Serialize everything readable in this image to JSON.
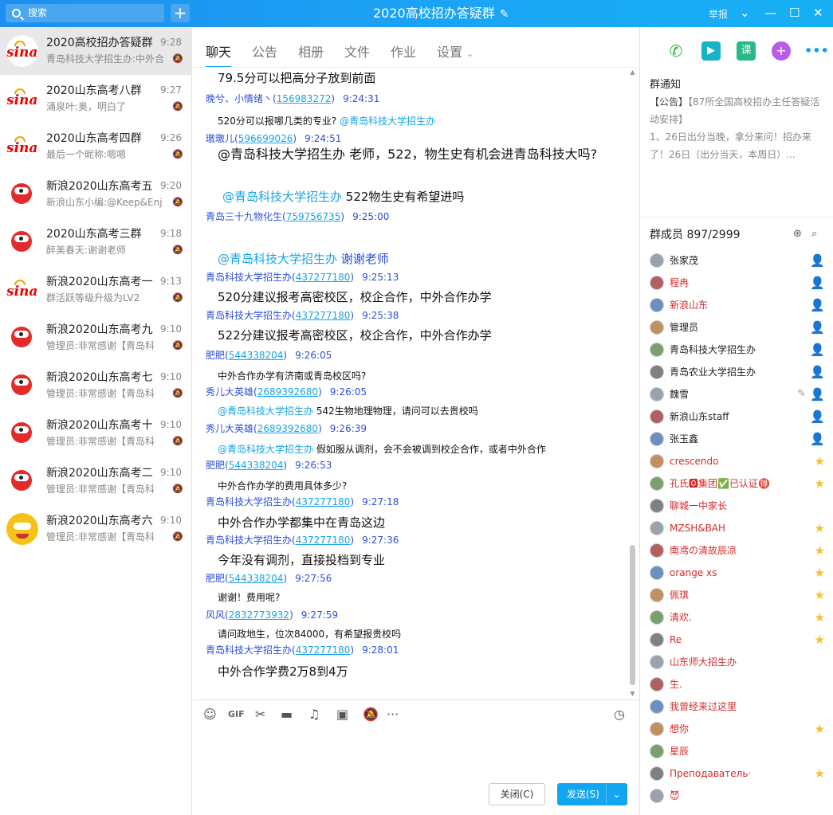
{
  "app": {
    "window_title": "2020高校招办答疑群",
    "report_label": "举报"
  },
  "search": {
    "placeholder": "搜索"
  },
  "conversations": [
    {
      "name": "2020高校招办答疑群",
      "time": "9:28",
      "preview": "青岛科技大学招生办:中外合",
      "avatar": "sina",
      "active": true
    },
    {
      "name": "2020山东高考八群",
      "time": "9:27",
      "preview": "涌泉叶:奥，明白了",
      "avatar": "sina"
    },
    {
      "name": "2020山东高考四群",
      "time": "9:26",
      "preview": "最后一个昵称:嗯嗯",
      "avatar": "sina"
    },
    {
      "name": "新浪2020山东高考五",
      "time": "9:20",
      "preview": "新浪山东小编:@Keep&Enj",
      "avatar": "mascot"
    },
    {
      "name": "2020山东高考三群",
      "time": "9:18",
      "preview": "醉美春天:谢谢老师",
      "avatar": "mascot"
    },
    {
      "name": "新浪2020山东高考一",
      "time": "9:13",
      "preview": "群活跃等级升级为LV2",
      "avatar": "sina"
    },
    {
      "name": "新浪2020山东高考九",
      "time": "9:10",
      "preview": "管理员:非常感谢【青岛科",
      "avatar": "mascot"
    },
    {
      "name": "新浪2020山东高考七",
      "time": "9:10",
      "preview": "管理员:非常感谢【青岛科",
      "avatar": "mascot"
    },
    {
      "name": "新浪2020山东高考十",
      "time": "9:10",
      "preview": "管理员:非常感谢【青岛科",
      "avatar": "mascot"
    },
    {
      "name": "新浪2020山东高考二",
      "time": "9:10",
      "preview": "管理员:非常感谢【青岛科",
      "avatar": "mascot"
    },
    {
      "name": "新浪2020山东高考六",
      "time": "9:10",
      "preview": "管理员:非常感谢【青岛科",
      "avatar": "yellow"
    }
  ],
  "tabs": {
    "chat": "聊天",
    "notice": "公告",
    "album": "相册",
    "files": "文件",
    "homework": "作业",
    "settings": "设置"
  },
  "messages": [
    {
      "kind": "body",
      "text": "79.5分可以把高分子放到前面",
      "size": 15
    },
    {
      "kind": "sender",
      "nick": "晚兮、小情绪丶",
      "qq": "156983272",
      "time": "9:24:31"
    },
    {
      "kind": "body",
      "text": "520分可以报哪几类的专业?",
      "at": "@青岛科技大学招生办",
      "at_after": true,
      "size": 12
    },
    {
      "kind": "sender",
      "nick": "璬璬儿",
      "qq": "596699026",
      "time": "9:24:51"
    },
    {
      "kind": "body",
      "text": "@青岛科技大学招生办 老师，522，物生史有机会进青岛科技大吗?",
      "size": 16
    },
    {
      "kind": "body",
      "at": "@青岛科技大学招生办",
      "text": " 522物生史有希望进吗",
      "size": 15,
      "indent": true
    },
    {
      "kind": "sender",
      "nick": "青岛三十九物化生",
      "qq": "759756735",
      "time": "9:25:00"
    },
    {
      "kind": "body",
      "at": "@青岛科技大学招生办",
      "text": "  谢谢老师",
      "text_color": "#2d4fd8",
      "size": 15
    },
    {
      "kind": "sender",
      "nick": "青岛科技大学招生办",
      "qq": "437277180",
      "time": "9:25:13"
    },
    {
      "kind": "body",
      "text": "520分建议报考高密校区，校企合作，中外合作办学",
      "size": 15
    },
    {
      "kind": "sender",
      "nick": "青岛科技大学招生办",
      "qq": "437277180",
      "time": "9:25:38"
    },
    {
      "kind": "body",
      "text": "522分建议报考高密校区，校企合作，中外合作办学",
      "size": 15
    },
    {
      "kind": "sender",
      "nick": "肥肥",
      "qq": "544338204",
      "time": "9:26:05"
    },
    {
      "kind": "body",
      "text": "中外合作办学有济南或青岛校区吗?",
      "size": 12
    },
    {
      "kind": "sender",
      "nick": "秀儿大英雄",
      "qq": "2689392680",
      "time": "9:26:05"
    },
    {
      "kind": "body",
      "at": "@青岛科技大学招生办",
      "text": " 542生物地理物理，请问可以去贵校吗",
      "size": 12
    },
    {
      "kind": "sender",
      "nick": "秀儿大英雄",
      "qq": "2689392680",
      "time": "9:26:39"
    },
    {
      "kind": "body",
      "at": "@青岛科技大学招生办",
      "text": " 假如服从调剂，会不会被调到校企合作，或者中外合作",
      "size": 12
    },
    {
      "kind": "sender",
      "nick": "肥肥",
      "qq": "544338204",
      "time": "9:26:53"
    },
    {
      "kind": "body",
      "text": "中外合作办学的费用具体多少?",
      "size": 12
    },
    {
      "kind": "sender",
      "nick": "青岛科技大学招生办",
      "qq": "437277180",
      "time": "9:27:18"
    },
    {
      "kind": "body",
      "text": "中外合作办学都集中在青岛这边",
      "size": 15
    },
    {
      "kind": "sender",
      "nick": "青岛科技大学招生办",
      "qq": "437277180",
      "time": "9:27:36"
    },
    {
      "kind": "body",
      "text": "今年没有调剂，直接投档到专业",
      "size": 15
    },
    {
      "kind": "sender",
      "nick": "肥肥",
      "qq": "544338204",
      "time": "9:27:56"
    },
    {
      "kind": "body",
      "text": "谢谢！费用呢?",
      "size": 12
    },
    {
      "kind": "sender",
      "nick": "风风",
      "qq": "2832773932",
      "time": "9:27:59"
    },
    {
      "kind": "body",
      "text": "请问政地生，位次84000，有希望报贵校吗",
      "size": 12
    },
    {
      "kind": "sender",
      "nick": "青岛科技大学招生办",
      "qq": "437277180",
      "time": "9:28:01"
    },
    {
      "kind": "body",
      "text": "中外合作学费2万8到4万",
      "size": 15
    }
  ],
  "composer": {
    "close_label": "关闭(C)",
    "send_label": "发送(S)"
  },
  "right": {
    "notice_title": "群通知",
    "notice_tag": "【公告】",
    "notice_head": "【87所全国高校招办主任答疑活动安排】",
    "notice_body": "1、26日出分当晚，拿分来问！招办来了！26日（出分当天，本周日）...",
    "members_title": "群成员 897/2999",
    "course_label": "课"
  },
  "members": [
    {
      "name": "张家茂",
      "color": "black",
      "role": "owner"
    },
    {
      "name": "程冉",
      "color": "red",
      "role": "admin"
    },
    {
      "name": "新浪山东",
      "color": "red",
      "role": "admin"
    },
    {
      "name": "管理员",
      "color": "black",
      "role": "admin"
    },
    {
      "name": "青岛科技大学招生办",
      "color": "black",
      "role": "admin"
    },
    {
      "name": "青岛农业大学招生办",
      "color": "black",
      "role": "admin"
    },
    {
      "name": "魏雪",
      "color": "black",
      "role": "admin"
    },
    {
      "name": "新浪山东staff",
      "color": "black",
      "role": "admin"
    },
    {
      "name": "张玉鑫",
      "color": "black",
      "role": "admin"
    },
    {
      "name": "crescendo",
      "color": "red",
      "role": "star"
    },
    {
      "name": "孔氏🅾集团✅已认证🉐",
      "color": "red",
      "role": "star"
    },
    {
      "name": "聊城一中家长",
      "color": "red",
      "role": ""
    },
    {
      "name": "MZSH&BAH",
      "color": "red",
      "role": "star"
    },
    {
      "name": "南鸢の清故辰凉",
      "color": "red",
      "role": "star"
    },
    {
      "name": "orange xs",
      "color": "red",
      "role": "star"
    },
    {
      "name": "佩琪",
      "color": "red",
      "role": "star"
    },
    {
      "name": "清欢.",
      "color": "red",
      "role": "star"
    },
    {
      "name": "Re",
      "color": "red",
      "role": "star"
    },
    {
      "name": "山东师大招生办",
      "color": "red",
      "role": ""
    },
    {
      "name": "生.",
      "color": "red",
      "role": ""
    },
    {
      "name": "我曾经来过这里",
      "color": "red",
      "role": ""
    },
    {
      "name": "想你",
      "color": "red",
      "role": "star"
    },
    {
      "name": "星辰",
      "color": "red",
      "role": ""
    },
    {
      "name": "Преподаватель·",
      "color": "red",
      "role": "star"
    },
    {
      "name": "😈",
      "color": "red",
      "role": ""
    }
  ],
  "colors": {
    "accent": "#1aa0f5",
    "link": "#2d4fd8",
    "at": "#17a3e5",
    "member_red": "#d62a2a"
  }
}
